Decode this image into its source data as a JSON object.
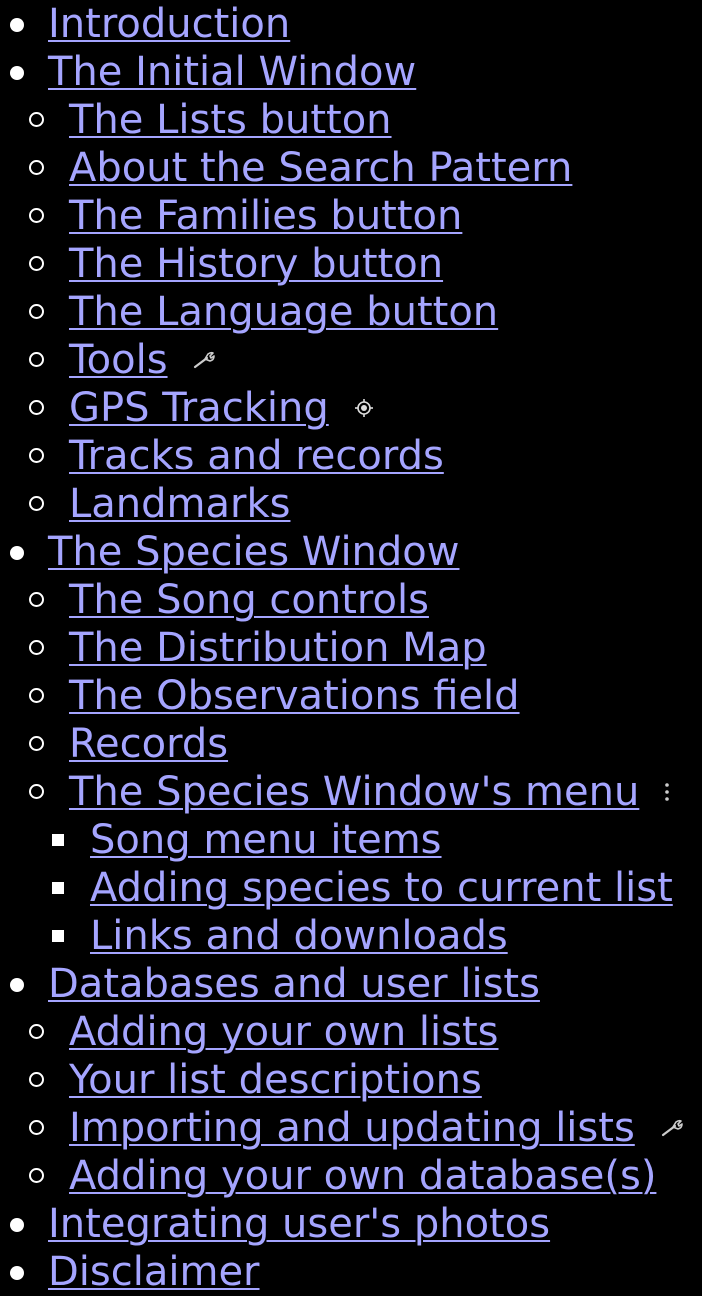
{
  "toc": {
    "introduction": "Introduction",
    "initial_window": {
      "label": "The Initial Window",
      "items": {
        "lists_button": "The Lists button",
        "search_pattern": "About the Search Pattern",
        "families_button": "The Families button",
        "history_button": "The History button",
        "language_button": "The Language button",
        "tools": "Tools",
        "gps_tracking": "GPS Tracking",
        "tracks_records": "Tracks and records",
        "landmarks": "Landmarks"
      }
    },
    "species_window": {
      "label": "The Species Window",
      "items": {
        "song_controls": "The Song controls",
        "distribution_map": "The Distribution Map",
        "observations_field": "The Observations field",
        "records": "Records",
        "species_menu": {
          "label": "The Species Window's menu",
          "items": {
            "song_menu_items": "Song menu items",
            "adding_species": "Adding species to current list",
            "links_downloads": "Links and downloads"
          }
        }
      }
    },
    "databases": {
      "label": "Databases and user lists",
      "items": {
        "own_lists": "Adding your own lists",
        "list_descriptions": "Your list descriptions",
        "importing_lists": "Importing and updating lists",
        "own_database": "Adding your own database(s)"
      }
    },
    "user_photos": "Integrating user's photos",
    "disclaimer": "Disclaimer"
  },
  "icons": {
    "tools": "wrench-icon",
    "gps_tracking": "gps-target-icon",
    "species_menu": "more-vertical-icon",
    "importing_lists": "wrench-icon"
  },
  "colors": {
    "background": "#000000",
    "link": "#a5a5ff",
    "bullet": "#ffffff"
  }
}
